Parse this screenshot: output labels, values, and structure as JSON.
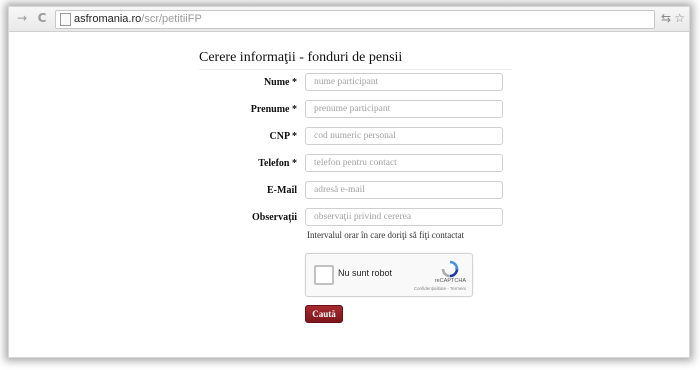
{
  "browser": {
    "url_domain": "asfromania.ro",
    "url_path": "/scr/petitiiFP",
    "back_icon": "→",
    "reload_icon": "C",
    "translate_icon": "⇆",
    "bookmark_icon": "☆"
  },
  "form": {
    "title": "Cerere informaţii - fonduri de pensii",
    "fields": [
      {
        "label": "Nume *",
        "placeholder": "nume participant"
      },
      {
        "label": "Prenume *",
        "placeholder": "prenume participant"
      },
      {
        "label": "CNP *",
        "placeholder": "cod numeric personal"
      },
      {
        "label": "Telefon *",
        "placeholder": "telefon pentru contact"
      },
      {
        "label": "E-Mail",
        "placeholder": "adresă e-mail"
      },
      {
        "label": "Observaţii",
        "placeholder": "observaţii privind cererea"
      }
    ],
    "help_text": "Intervalul orar în care doriţi să fiţi contactat",
    "captcha": {
      "label": "Nu sunt robot",
      "brand": "reCAPTCHA",
      "legal": "Confidențialitate - Termeni"
    },
    "submit_label": "Caută"
  }
}
